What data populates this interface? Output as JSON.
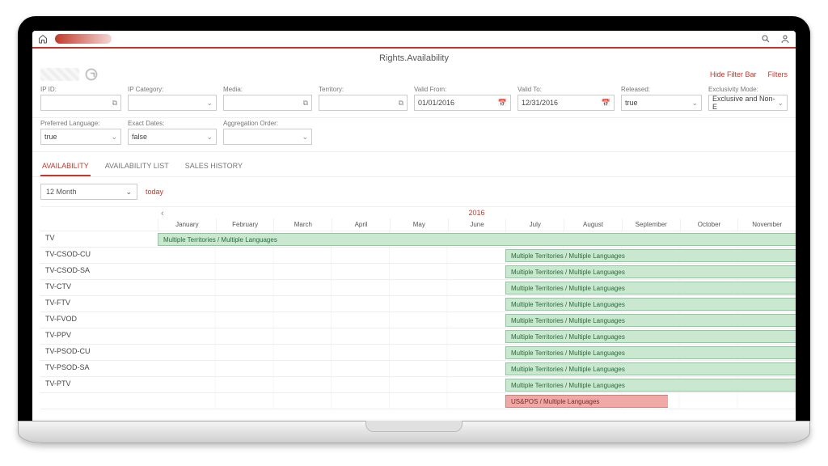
{
  "app": {
    "title": "Rights.Availability"
  },
  "header": {
    "hide_filter_bar": "Hide Filter Bar",
    "filters_link": "Filters"
  },
  "filters": {
    "ip_id": {
      "label": "IP ID:",
      "value": ""
    },
    "ip_category": {
      "label": "IP Category:",
      "value": ""
    },
    "media": {
      "label": "Media:",
      "value": ""
    },
    "territory": {
      "label": "Territory:",
      "value": ""
    },
    "valid_from": {
      "label": "Valid From:",
      "value": "01/01/2016"
    },
    "valid_to": {
      "label": "Valid To:",
      "value": "12/31/2016"
    },
    "released": {
      "label": "Released:",
      "value": "true"
    },
    "exclusivity": {
      "label": "Exclusivity Mode:",
      "value": "Exclusive and Non-E"
    },
    "preferred_language": {
      "label": "Preferred Language:",
      "value": "true"
    },
    "exact_dates": {
      "label": "Exact Dates:",
      "value": "false"
    },
    "aggregation_order": {
      "label": "Aggregation Order:",
      "value": ""
    }
  },
  "tabs": [
    "AVAILABILITY",
    "AVAILABILITY LIST",
    "SALES HISTORY"
  ],
  "active_tab": "AVAILABILITY",
  "controls": {
    "range": "12 Month",
    "today": "today"
  },
  "timeline": {
    "year": "2016",
    "months": [
      "January",
      "February",
      "March",
      "April",
      "May",
      "June",
      "July",
      "August",
      "September",
      "October",
      "November"
    ],
    "bar_label": "Multiple Territories / Multiple Languages",
    "bar_label_red": "US&POS / Multiple Languages",
    "rows": [
      {
        "label": "TV",
        "start_pct": 0,
        "color": "green",
        "text": "Multiple Territories / Multiple Languages"
      },
      {
        "label": "TV-CSOD-CU",
        "start_pct": 54.5,
        "color": "green",
        "text": "Multiple Territories / Multiple Languages"
      },
      {
        "label": "TV-CSOD-SA",
        "start_pct": 54.5,
        "color": "green",
        "text": "Multiple Territories / Multiple Languages"
      },
      {
        "label": "TV-CTV",
        "start_pct": 54.5,
        "color": "green",
        "text": "Multiple Territories / Multiple Languages"
      },
      {
        "label": "TV-FTV",
        "start_pct": 54.5,
        "color": "green",
        "text": "Multiple Territories / Multiple Languages"
      },
      {
        "label": "TV-FVOD",
        "start_pct": 54.5,
        "color": "green",
        "text": "Multiple Territories / Multiple Languages"
      },
      {
        "label": "TV-PPV",
        "start_pct": 54.5,
        "color": "green",
        "text": "Multiple Territories / Multiple Languages"
      },
      {
        "label": "TV-PSOD-CU",
        "start_pct": 54.5,
        "color": "green",
        "text": "Multiple Territories / Multiple Languages"
      },
      {
        "label": "TV-PSOD-SA",
        "start_pct": 54.5,
        "color": "green",
        "text": "Multiple Territories / Multiple Languages"
      },
      {
        "label": "TV-PTV",
        "start_pct": 54.5,
        "color": "green",
        "text": "Multiple Territories / Multiple Languages"
      },
      {
        "label": "",
        "start_pct": 54.5,
        "color": "red",
        "text": "US&POS / Multiple Languages",
        "end_pct": 80
      }
    ]
  }
}
